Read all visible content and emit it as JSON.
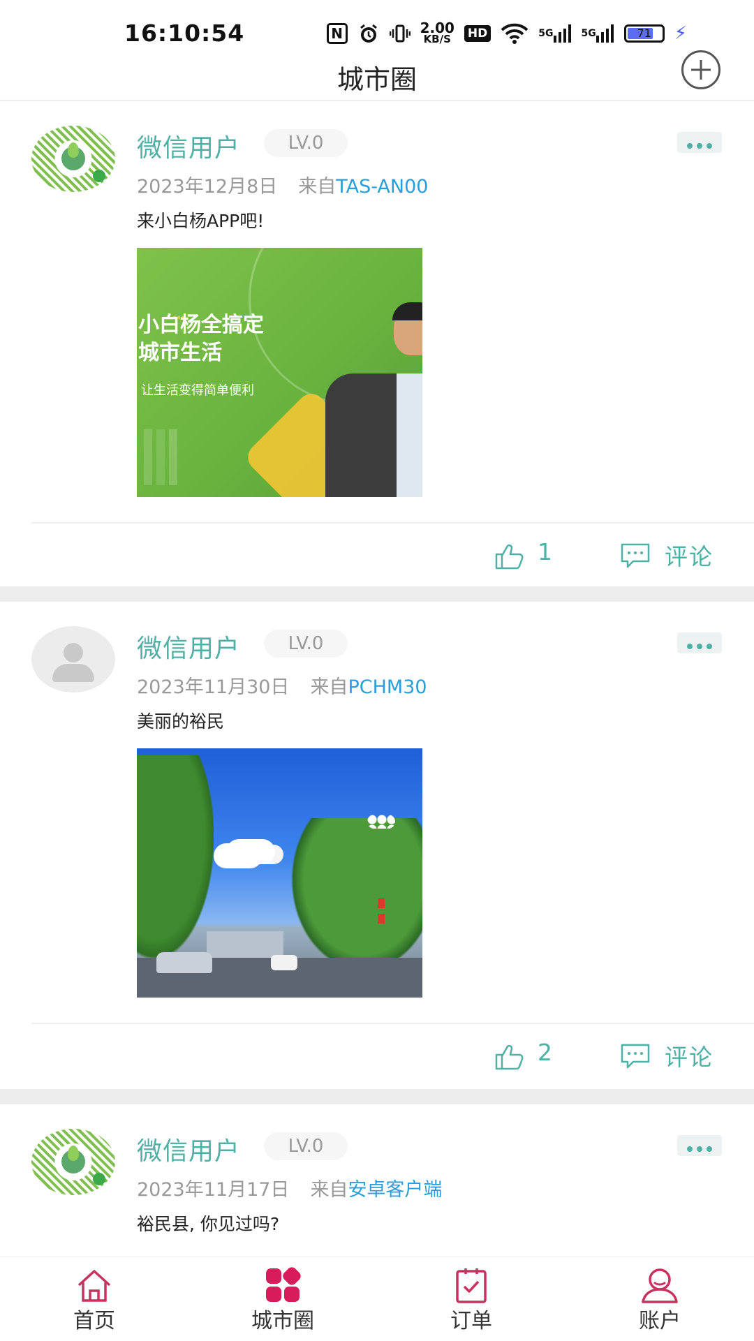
{
  "status_bar": {
    "time": "16:10:54",
    "network_speed_value": "2.00",
    "network_speed_unit": "KB/S",
    "hd_label": "HD",
    "signal_1": "5G",
    "signal_2": "5G",
    "battery": "71",
    "icons": [
      "nfc-icon",
      "alarm-icon",
      "vibrate-icon",
      "hd-icon",
      "wifi-icon",
      "signal-5g-icon",
      "signal-5g-icon",
      "battery-icon",
      "charging-icon"
    ]
  },
  "header": {
    "title": "城市圈",
    "add_icon": "plus-circle-icon"
  },
  "colors": {
    "accent": "#4fb0a6",
    "device_link": "#2a9ed8",
    "tab_active": "#d81b5a",
    "tab_inactive": "#c7325f"
  },
  "posts": [
    {
      "username": "微信用户",
      "level": "LV.0",
      "date": "2023年12月8日",
      "from_label": "来自",
      "device": "TAS-AN00",
      "content": "来小白杨APP吧!",
      "image_text": {
        "line1": "小白杨全搞定",
        "line2": "城市生活",
        "line3": "让生活变得简单便利"
      },
      "likes": "1",
      "comment_label": "评论"
    },
    {
      "username": "微信用户",
      "level": "LV.0",
      "date": "2023年11月30日",
      "from_label": "来自",
      "device": "PCHM30",
      "content": "美丽的裕民",
      "likes": "2",
      "comment_label": "评论"
    },
    {
      "username": "微信用户",
      "level": "LV.0",
      "date": "2023年11月17日",
      "from_label": "来自",
      "device": "安卓客户端",
      "content": "裕民县, 你见过吗?"
    }
  ],
  "tabbar": {
    "tabs": [
      {
        "label": "首页",
        "icon": "home-icon"
      },
      {
        "label": "城市圈",
        "icon": "city-circle-icon",
        "active": true
      },
      {
        "label": "订单",
        "icon": "order-icon"
      },
      {
        "label": "账户",
        "icon": "account-icon"
      }
    ]
  }
}
